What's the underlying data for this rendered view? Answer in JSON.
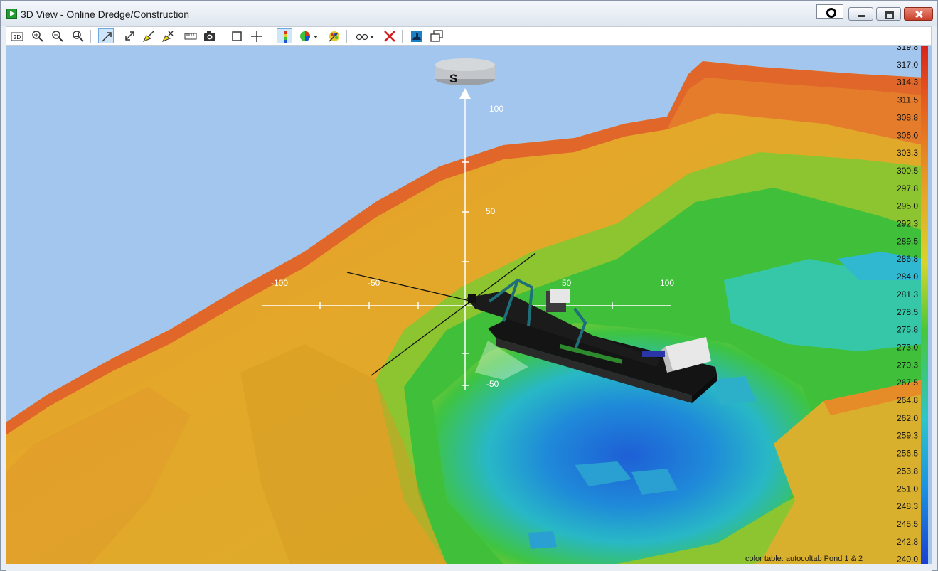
{
  "window": {
    "title": "3D View - Online Dredge/Construction"
  },
  "toolbar": {
    "buttons": [
      {
        "id": "2d",
        "label": "2D",
        "icon": "view-2d-icon",
        "active": false
      },
      {
        "id": "zoom-in",
        "icon": "zoom-in-icon",
        "active": false
      },
      {
        "id": "zoom-out",
        "icon": "zoom-out-icon",
        "active": false
      },
      {
        "id": "zoom-fit",
        "icon": "zoom-extents-icon",
        "active": false
      },
      {
        "id": "rotate",
        "icon": "rotate-view-icon",
        "active": true
      },
      {
        "id": "pan",
        "icon": "pan-icon",
        "active": false
      },
      {
        "id": "highlight",
        "icon": "highlight-icon",
        "active": false
      },
      {
        "id": "mark",
        "icon": "mark-icon",
        "active": false
      },
      {
        "id": "measure",
        "icon": "ruler-icon",
        "active": false
      },
      {
        "id": "snapshot",
        "icon": "camera-icon",
        "active": false
      },
      {
        "id": "box",
        "icon": "square-icon",
        "active": false
      },
      {
        "id": "crosshair",
        "icon": "crosshair-icon",
        "active": false
      },
      {
        "id": "color-scale",
        "icon": "color-scale-icon",
        "active": true
      },
      {
        "id": "color-table",
        "icon": "color-table-icon",
        "active": false
      },
      {
        "id": "palette",
        "icon": "palette-icon",
        "active": false
      },
      {
        "id": "view-options",
        "icon": "glasses-icon",
        "active": false
      },
      {
        "id": "delete",
        "icon": "delete-x-icon",
        "active": false
      },
      {
        "id": "vessel",
        "icon": "vessel-icon",
        "active": false
      },
      {
        "id": "windows",
        "icon": "windows-icon",
        "active": false
      }
    ]
  },
  "axes": {
    "x_labels": [
      "-100",
      "-50",
      "50",
      "100"
    ],
    "y_labels": [
      "100",
      "50",
      "-50"
    ],
    "compass_label": "S"
  },
  "color_scale": {
    "values": [
      "319.8",
      "317.0",
      "314.3",
      "311.5",
      "308.8",
      "306.0",
      "303.3",
      "300.5",
      "297.8",
      "295.0",
      "292.3",
      "289.5",
      "286.8",
      "284.0",
      "281.3",
      "278.5",
      "275.8",
      "273.0",
      "270.3",
      "267.5",
      "264.8",
      "262.0",
      "259.3",
      "256.5",
      "253.8",
      "251.0",
      "248.3",
      "245.5",
      "242.8",
      "240.0"
    ]
  },
  "status": {
    "text": "color table: autocoltab  Pond 1 & 2"
  },
  "colors": {
    "sky": "#a3c6ee",
    "high": "#d9541e",
    "mid": "#e6b328",
    "low_green": "#3fbf3a",
    "low_cyan": "#25a6cf",
    "deep": "#1c55d0"
  }
}
